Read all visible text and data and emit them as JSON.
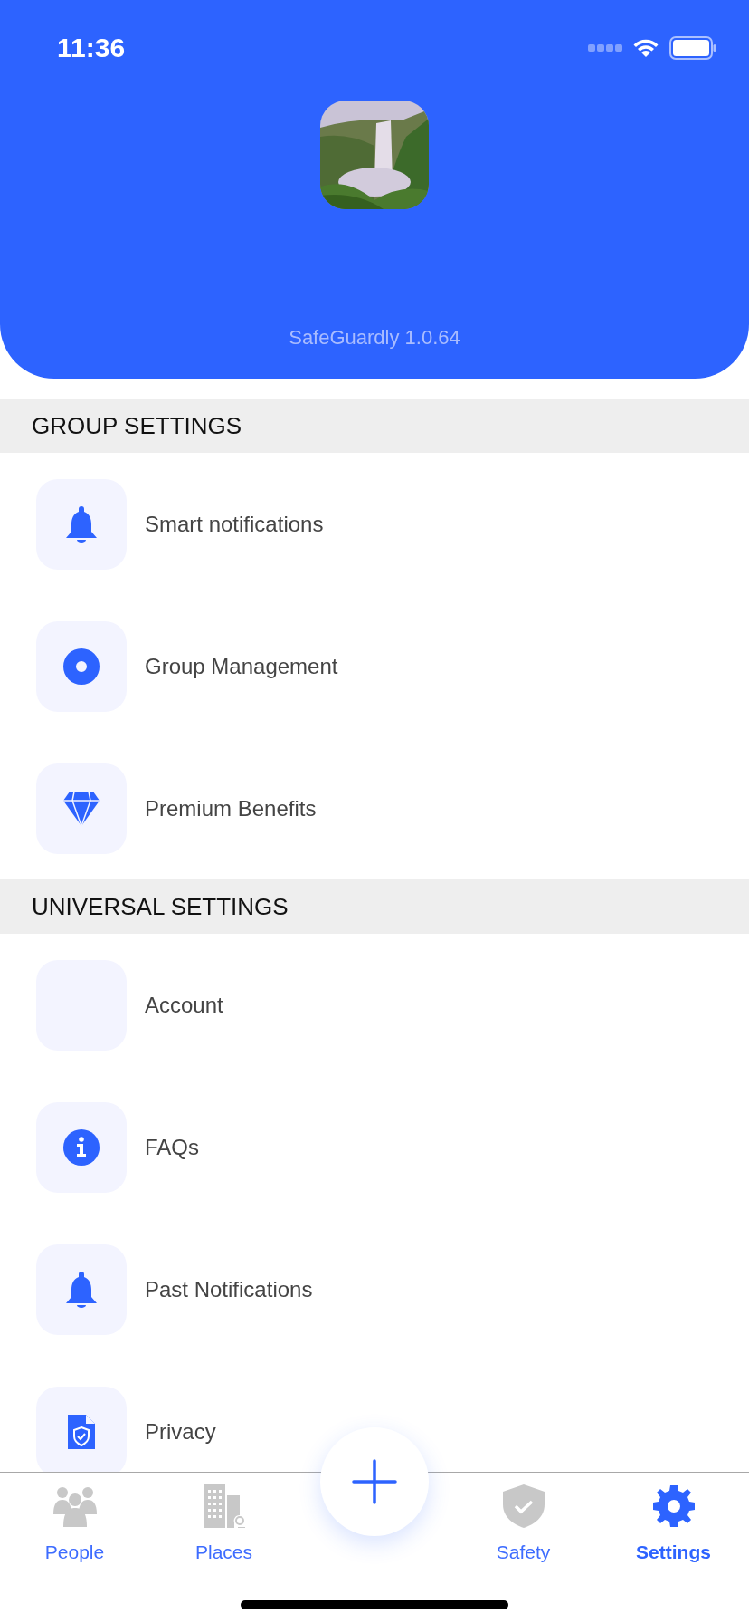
{
  "status_bar": {
    "time": "11:36"
  },
  "profile": {
    "version": "SafeGuardly 1.0.64"
  },
  "sections": [
    {
      "title": "GROUP SETTINGS",
      "items": [
        {
          "label": "Smart notifications"
        },
        {
          "label": "Group Management"
        },
        {
          "label": "Premium Benefits"
        }
      ]
    },
    {
      "title": "UNIVERSAL SETTINGS",
      "items": [
        {
          "label": "Account"
        },
        {
          "label": "FAQs"
        },
        {
          "label": "Past Notifications"
        },
        {
          "label": "Privacy"
        }
      ]
    }
  ],
  "tab_bar": {
    "tabs": [
      {
        "label": "People",
        "selected": false
      },
      {
        "label": "Places",
        "selected": false
      },
      {
        "label": "Safety",
        "selected": false
      },
      {
        "label": "Settings",
        "selected": true
      }
    ]
  }
}
